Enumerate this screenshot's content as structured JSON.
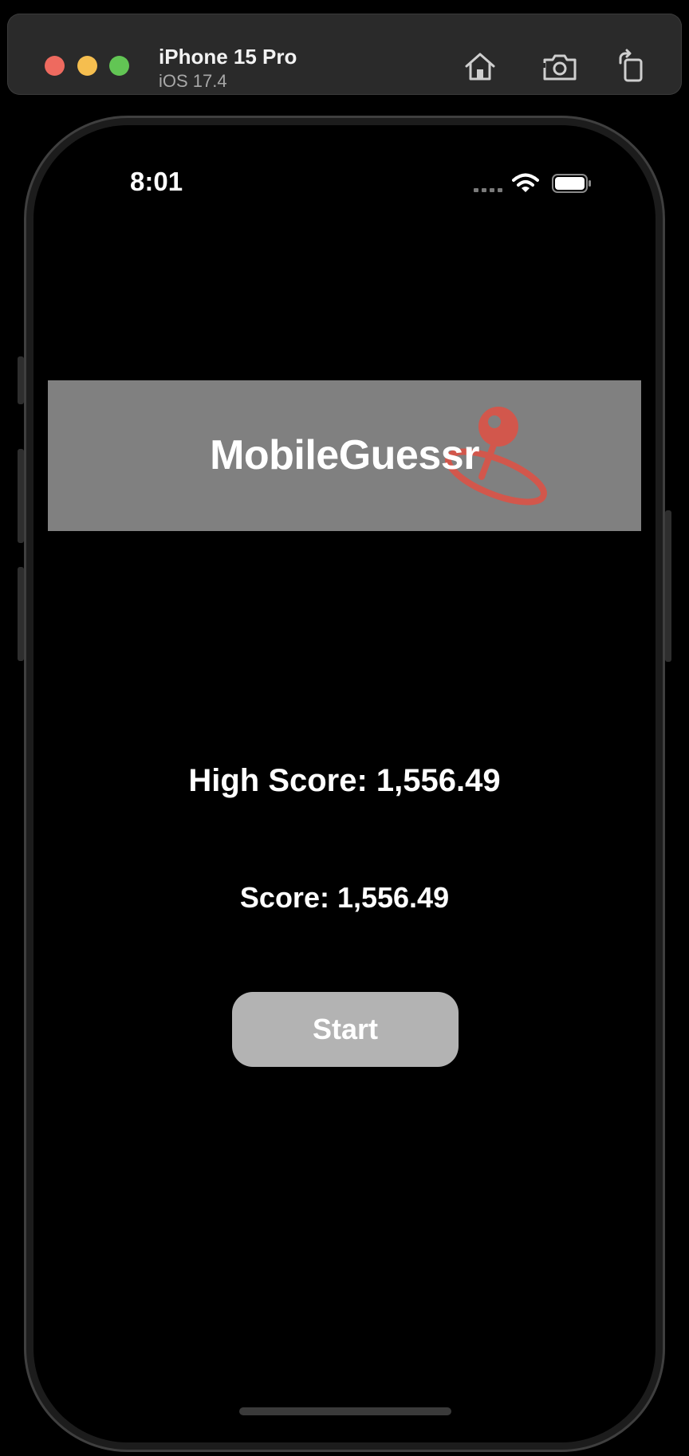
{
  "simulator": {
    "device_name": "iPhone 15 Pro",
    "os_version": "iOS 17.4",
    "window_controls": {
      "close_color": "#ee6a5f",
      "minimize_color": "#f5be4f",
      "zoom_color": "#62c554"
    },
    "toolbar_icons": [
      "home-icon",
      "screenshot-icon",
      "rotate-icon"
    ]
  },
  "status_bar": {
    "time": "8:01",
    "icons": [
      "cellular-dots-icon",
      "wifi-icon",
      "battery-icon"
    ]
  },
  "banner": {
    "title": "MobileGuessr",
    "background_color": "#808080",
    "logo_icon": "map-pin-icon",
    "logo_color": "#d2574c"
  },
  "scores": {
    "high_score_text": "High Score: 1,556.49",
    "score_text": "Score: 1,556.49"
  },
  "actions": {
    "start_label": "Start",
    "start_color": "#b3b3b3"
  }
}
